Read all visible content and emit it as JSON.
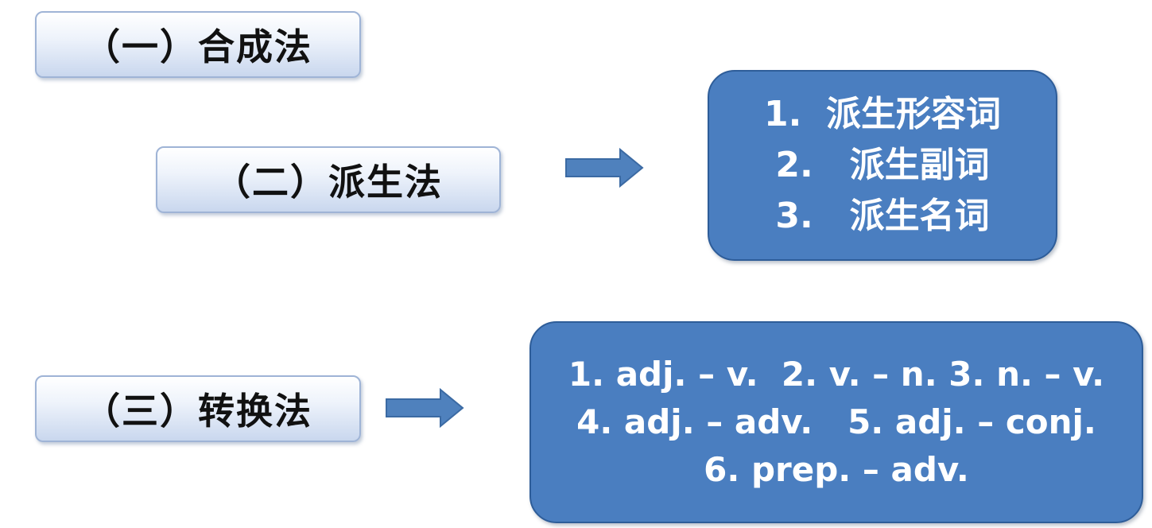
{
  "methods": {
    "compound": {
      "label": "（一）合成法"
    },
    "derivation": {
      "label": "（二）派生法",
      "items": [
        "1.  派生形容词",
        "2.   派生副词",
        "3.   派生名词"
      ]
    },
    "conversion": {
      "label": "（三）转换法",
      "lines": [
        "1. adj. – v.  2. v. – n. 3. n. – v.",
        "4. adj. – adv.   5. adj. – conj.",
        "6. prep. – adv."
      ]
    }
  },
  "colors": {
    "box_fill": "#4a7ec0",
    "box_border": "#2e5d99",
    "arrow_fill": "#4f81bd",
    "label_border": "#9fb4d6"
  }
}
